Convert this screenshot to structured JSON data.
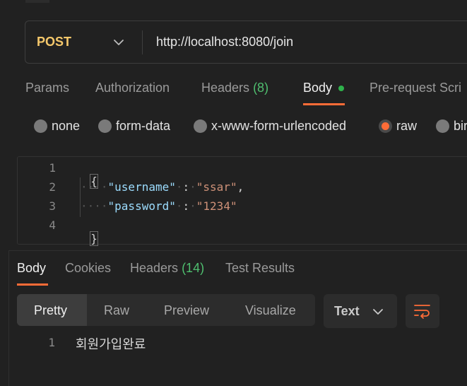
{
  "request": {
    "method": "POST",
    "url": "http://localhost:8080/join"
  },
  "request_tabs": {
    "params": "Params",
    "authorization": "Authorization",
    "headers_label": "Headers",
    "headers_count": "(8)",
    "body": "Body",
    "prerequest": "Pre-request Scri"
  },
  "body_types": {
    "none": "none",
    "form_data": "form-data",
    "urlencoded": "x-www-form-urlencoded",
    "raw": "raw",
    "binary": "bir"
  },
  "editor": {
    "line_numbers": [
      "1",
      "2",
      "3",
      "4"
    ],
    "open_brace": "{",
    "close_brace": "}",
    "indent": "····",
    "key1": "\"username\"",
    "val1": "\"ssar\"",
    "key2": "\"password\"",
    "val2": "\"1234\"",
    "colon": ":",
    "comma": ","
  },
  "response_tabs": {
    "body": "Body",
    "cookies": "Cookies",
    "headers_label": "Headers",
    "headers_count": "(14)",
    "test_results": "Test Results"
  },
  "view_modes": {
    "pretty": "Pretty",
    "raw": "Raw",
    "preview": "Preview",
    "visualize": "Visualize"
  },
  "format": "Text",
  "response": {
    "line_number": "1",
    "text": "회원가입완료"
  },
  "colors": {
    "accent": "#ff6c37",
    "method": "#f5c86b",
    "count": "#4fbf6f",
    "status_dot": "#2fb24c"
  }
}
